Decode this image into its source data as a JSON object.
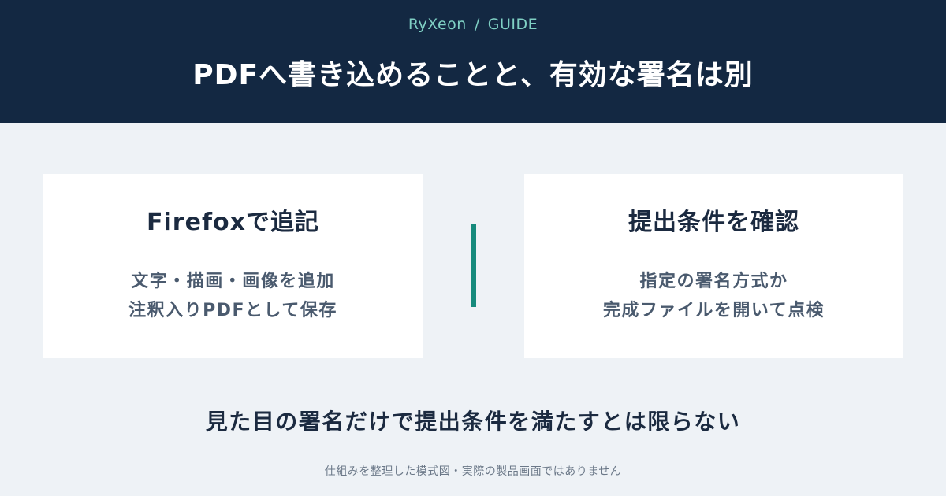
{
  "header": {
    "brand": "RyXeon",
    "separator": "/",
    "section": "GUIDE",
    "title": "PDFへ書き込めることと、有効な署名は別"
  },
  "cards": [
    {
      "title": "Firefoxで追記",
      "lines": [
        "文字・描画・画像を追加",
        "注釈入りPDFとして保存"
      ]
    },
    {
      "title": "提出条件を確認",
      "lines": [
        "指定の署名方式か",
        "完成ファイルを開いて点検"
      ]
    }
  ],
  "summary": "見た目の署名だけで提出条件を満たすとは限らない",
  "footnote": "仕組みを整理した模式図・実際の製品画面ではありません",
  "colors": {
    "header_bg": "#132842",
    "brand": "#7fd0c4",
    "divider": "#168a7c",
    "page_bg": "#eef2f6"
  }
}
